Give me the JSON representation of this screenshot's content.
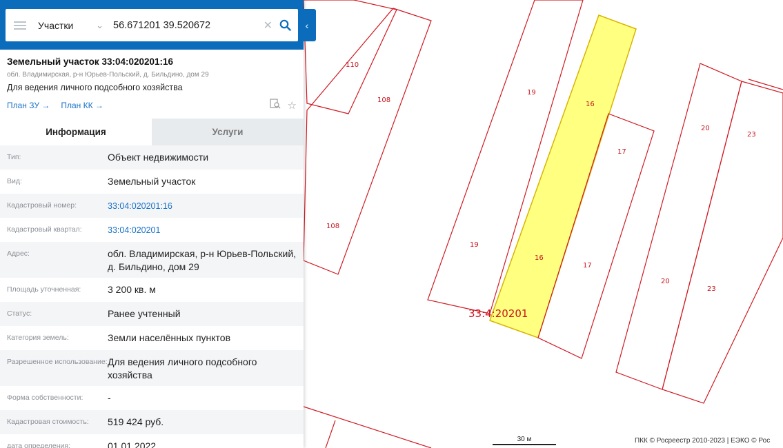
{
  "search": {
    "layer": "Участки",
    "query": "56.671201 39.520672"
  },
  "card": {
    "title": "Земельный участок 33:04:020201:16",
    "address": "обл. Владимирская, р-н Юрьев-Польский, д. Бильдино, дом 29",
    "use": "Для ведения личного подсобного хозяйства",
    "link_plan_zu": "План ЗУ →",
    "link_plan_kk": "План КК →"
  },
  "tabs": {
    "info": "Информация",
    "services": "Услуги"
  },
  "rows": [
    {
      "label": "Тип:",
      "value": "Объект недвижимости"
    },
    {
      "label": "Вид:",
      "value": "Земельный участок"
    },
    {
      "label": "Кадастровый номер:",
      "value": "33:04:020201:16"
    },
    {
      "label": "Кадастровый квартал:",
      "value": "33:04:020201"
    },
    {
      "label": "Адрес:",
      "value": "обл. Владимирская, р-н Юрьев-Польский, д. Бильдино, дом 29"
    },
    {
      "label": "Площадь уточненная:",
      "value": "3 200 кв. м"
    },
    {
      "label": "Статус:",
      "value": "Ранее учтенный"
    },
    {
      "label": "Категория земель:",
      "value": "Земли населённых пунктов"
    },
    {
      "label": "Разрешенное использование:",
      "value": "Для ведения личного подсобного хозяйства"
    },
    {
      "label": "Форма собственности:",
      "value": "-"
    },
    {
      "label": "Кадастровая стоимость:",
      "value": "519 424 руб."
    },
    {
      "label": "дата определения:",
      "value": "01.01.2022"
    }
  ],
  "map": {
    "plot_labels": [
      "110",
      "108",
      "108",
      "19",
      "19",
      "16",
      "16",
      "17",
      "17",
      "20",
      "20",
      "23",
      "23"
    ],
    "quarter_label": "33:4:20201",
    "scale": "30 м",
    "copyright": "ПКК © Росреестр 2010-2023 | ЕЭКО © Рос"
  },
  "colors": {
    "header_blue": "#0a6cbb",
    "parcel_line": "#d01a22",
    "selected_fill": "#ffff80",
    "link": "#1a73c7"
  }
}
